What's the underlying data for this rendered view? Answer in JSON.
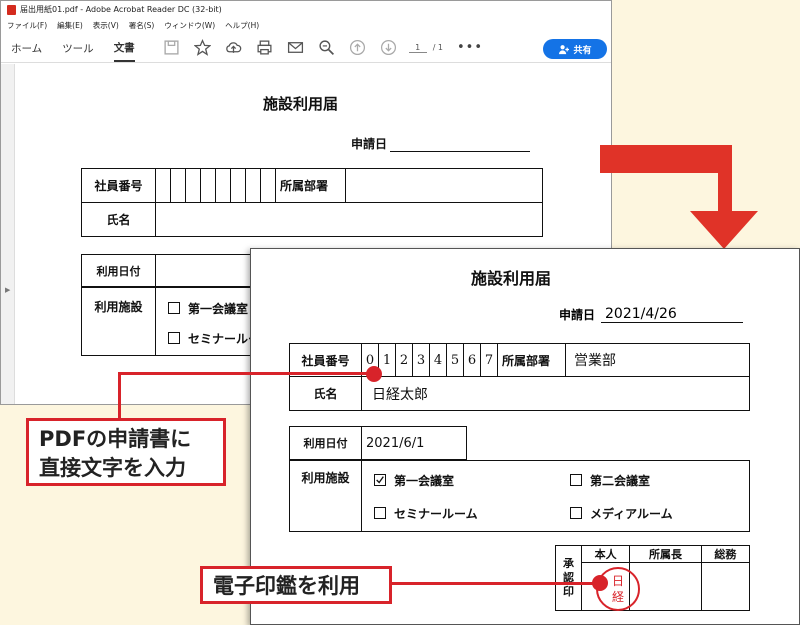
{
  "window": {
    "title": "届出用紙01.pdf - Adobe Acrobat Reader DC (32-bit)",
    "menu": [
      "ファイル(F)",
      "編集(E)",
      "表示(V)",
      "署名(S)",
      "ウィンドウ(W)",
      "ヘルプ(H)"
    ],
    "tabs": [
      "ホーム",
      "ツール",
      "文書"
    ],
    "page_current": "1",
    "page_total": "/ 1",
    "share_label": "共有",
    "accent": "#1473e6"
  },
  "form": {
    "title": "施設利用届",
    "application_date_label": "申請日",
    "employee_no_label": "社員番号",
    "department_label": "所属部署",
    "name_label": "氏名",
    "use_date_label": "利用日付",
    "facility_label": "利用施設",
    "facility_options": [
      "第一会議室",
      "第二会議室",
      "セミナールーム",
      "メディアルーム"
    ],
    "approval_label": "承認印",
    "approval_cols": [
      "本人",
      "所属長",
      "総務"
    ]
  },
  "filled": {
    "application_date": "2021/4/26",
    "employee_digits": [
      "0",
      "1",
      "2",
      "3",
      "4",
      "5",
      "6",
      "7"
    ],
    "department": "営業部",
    "name": "日経太郎",
    "use_date": "2021/6/1",
    "stamp_chars": [
      "日",
      "経"
    ]
  },
  "callouts": {
    "direct_text_line1": "PDFの申請書に",
    "direct_text_line2": "直接文字を入力",
    "seal": "電子印鑑を利用"
  },
  "colors": {
    "callout_red": "#d8232a",
    "background": "#fdf6df"
  }
}
